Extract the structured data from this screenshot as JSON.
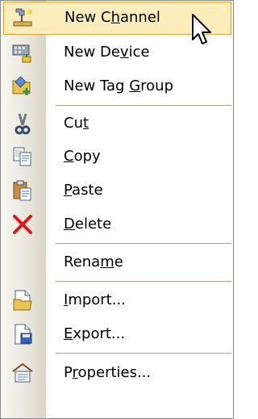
{
  "context_menu": {
    "items": [
      {
        "pre": "New C",
        "mn": "h",
        "post": "annel",
        "icon": "new-channel-icon"
      },
      {
        "pre": "New De",
        "mn": "v",
        "post": "ice",
        "icon": "new-device-icon"
      },
      {
        "pre": "New Tag ",
        "mn": "G",
        "post": "roup",
        "icon": "new-tag-group-icon"
      },
      {
        "pre": "Cu",
        "mn": "t",
        "post": "",
        "icon": "scissors-icon"
      },
      {
        "pre": "",
        "mn": "C",
        "post": "opy",
        "icon": "copy-icon"
      },
      {
        "pre": "",
        "mn": "P",
        "post": "aste",
        "icon": "paste-icon"
      },
      {
        "pre": "",
        "mn": "D",
        "post": "elete",
        "icon": "delete-x-icon"
      },
      {
        "pre": "Rena",
        "mn": "m",
        "post": "e",
        "icon": ""
      },
      {
        "pre": "",
        "mn": "I",
        "post": "mport...",
        "icon": "import-icon"
      },
      {
        "pre": "",
        "mn": "E",
        "post": "xport...",
        "icon": "export-icon"
      },
      {
        "pre": "P",
        "mn": "r",
        "post": "operties...",
        "icon": "properties-icon"
      }
    ],
    "highlight_color": "#ffeebc",
    "highlight_border": "#e8a13a"
  }
}
